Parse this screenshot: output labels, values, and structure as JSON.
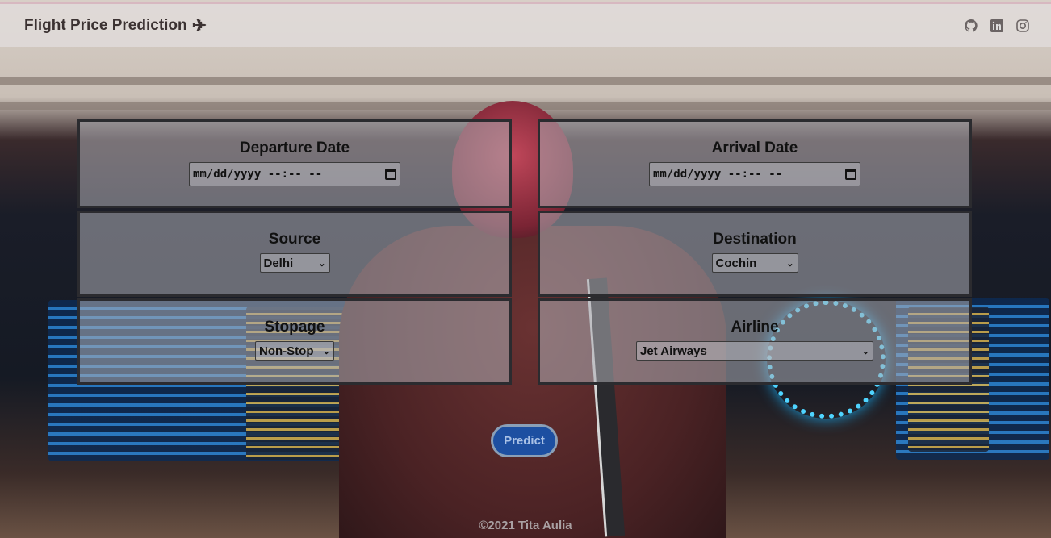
{
  "navbar": {
    "brand": "Flight Price Prediction",
    "brand_icon": "airplane-icon",
    "social_icons": [
      "github-icon",
      "linkedin-icon",
      "instagram-icon"
    ]
  },
  "form": {
    "departure": {
      "label": "Departure Date",
      "value": "mm/dd/yyyy --:-- --"
    },
    "arrival": {
      "label": "Arrival Date",
      "value": "mm/dd/yyyy --:-- --"
    },
    "source": {
      "label": "Source",
      "selected": "Delhi"
    },
    "destination": {
      "label": "Destination",
      "selected": "Cochin"
    },
    "stopage": {
      "label": "Stopage",
      "selected": "Non-Stop"
    },
    "airline": {
      "label": "Airline",
      "selected": "Jet Airways"
    }
  },
  "predict_label": "Predict",
  "footer": "©2021 Tita Aulia",
  "colors": {
    "predict_button": "#1d4fa1",
    "panel_border": "#2b2b2f"
  }
}
